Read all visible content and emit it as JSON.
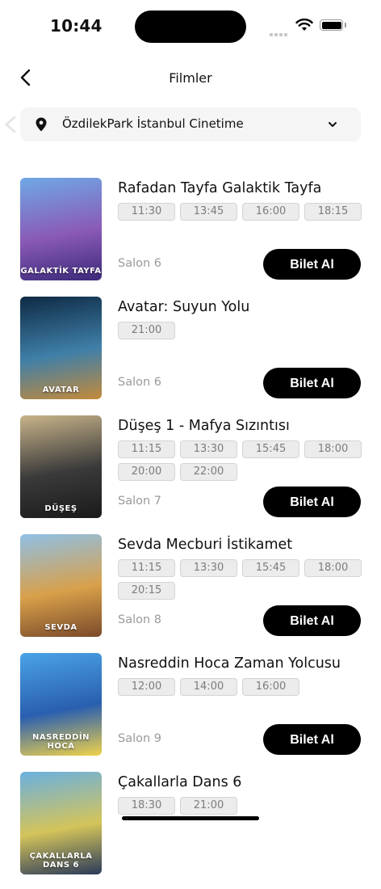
{
  "status_bar": {
    "time": "10:44"
  },
  "nav": {
    "title": "Filmler",
    "back_icon": "chevron-left-icon"
  },
  "location": {
    "cinema": "ÖzdilekPark İstanbul Cinetime",
    "pin_icon": "map-pin-icon",
    "dropdown_icon": "chevron-down-icon"
  },
  "buy_label": "Bilet Al",
  "movies": [
    {
      "title": "Rafadan Tayfa Galaktik Tayfa",
      "times": [
        "11:30",
        "13:45",
        "16:00",
        "18:15"
      ],
      "salon": "Salon 6",
      "poster_colors": [
        "#6fa8e6",
        "#8a5ab6",
        "#3b2a7a"
      ],
      "poster_caption": "GALAKTİK TAYFA"
    },
    {
      "title": "Avatar: Suyun Yolu",
      "times": [
        "21:00"
      ],
      "salon": "Salon 6",
      "poster_colors": [
        "#0e2a44",
        "#3f7fa8",
        "#c48a3a"
      ],
      "poster_caption": "AVATAR"
    },
    {
      "title": "Düşeş 1 - Mafya Sızıntısı",
      "times": [
        "11:15",
        "13:30",
        "15:45",
        "18:00",
        "20:00",
        "22:00"
      ],
      "salon": "Salon 7",
      "poster_colors": [
        "#c9b48a",
        "#3a3a3a",
        "#1a1a1a"
      ],
      "poster_caption": "DÜŞEŞ"
    },
    {
      "title": "Sevda Mecburi İstikamet",
      "times": [
        "11:15",
        "13:30",
        "15:45",
        "18:00",
        "20:15"
      ],
      "salon": "Salon 8",
      "poster_colors": [
        "#8fc0e6",
        "#d8a04a",
        "#7a4a2a"
      ],
      "poster_caption": "SEVDA"
    },
    {
      "title": "Nasreddin Hoca Zaman Yolcusu",
      "times": [
        "12:00",
        "14:00",
        "16:00"
      ],
      "salon": "Salon 9",
      "poster_colors": [
        "#4aa3e6",
        "#2a5fb0",
        "#f0d24a"
      ],
      "poster_caption": "NASREDDİN HOCA"
    },
    {
      "title": "Çakallarla Dans 6",
      "times": [
        "18:30",
        "21:00"
      ],
      "salon": "",
      "poster_colors": [
        "#6ab0e0",
        "#d4c45a",
        "#2a3a5a"
      ],
      "poster_caption": "ÇAKALLARLA DANS 6"
    }
  ]
}
